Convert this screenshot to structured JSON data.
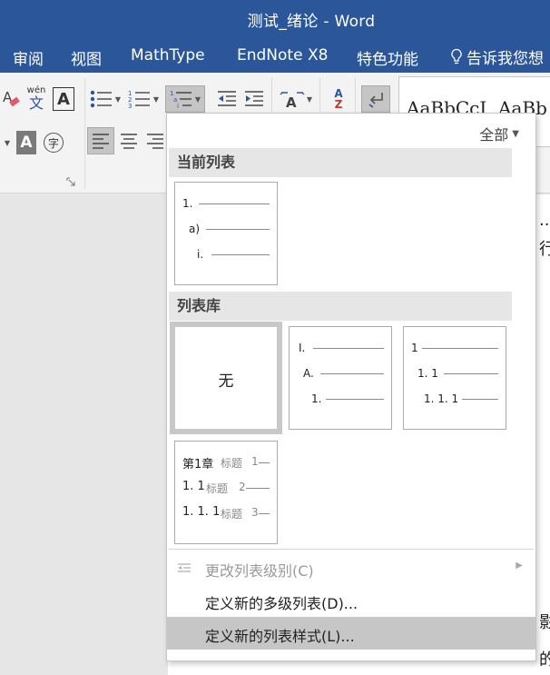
{
  "window": {
    "title": "测试_绪论 - Word"
  },
  "ribbon_tabs": [
    "审阅",
    "视图",
    "MathType",
    "EndNote X8",
    "特色功能"
  ],
  "tell_me": "告诉我您想",
  "ribbon": {
    "phonetic_glyph_top": "wén",
    "phonetic_glyph_bottom": "文",
    "char_border_glyph": "A",
    "char_shading_glyph": "A",
    "enclose_glyph": "字",
    "sort_glyph_top": "A",
    "sort_glyph_bottom": "Z",
    "styles_preview_1": "AaBbCcI",
    "styles_preview_2": "AaBb"
  },
  "doc": {
    "text_1": "...",
    "text_2": "行",
    "text_3": "影",
    "text_4": "的"
  },
  "dropdown": {
    "filter_label": "全部",
    "current_list_heading": "当前列表",
    "library_heading": "列表库",
    "current_list": [
      {
        "num": "1."
      },
      {
        "num": "a)"
      },
      {
        "num": "i."
      }
    ],
    "library": {
      "none_label": "无",
      "roman": [
        {
          "num": "I."
        },
        {
          "num": "A."
        },
        {
          "num": "1."
        }
      ],
      "decimal": [
        {
          "num": "1"
        },
        {
          "num": "1. 1"
        },
        {
          "num": "1. 1. 1"
        }
      ],
      "heading": [
        {
          "num": "第1章",
          "heading": "标题",
          "level": "1"
        },
        {
          "num": "1. 1",
          "heading": "标题",
          "level": "2"
        },
        {
          "num": "1. 1. 1",
          "heading": "标题",
          "level": "3"
        }
      ]
    },
    "menu": [
      {
        "label": "更改列表级别(C)",
        "state": "disabled"
      },
      {
        "label": "定义新的多级列表(D)...",
        "state": "normal"
      },
      {
        "label": "定义新的列表样式(L)...",
        "state": "hover"
      }
    ]
  }
}
